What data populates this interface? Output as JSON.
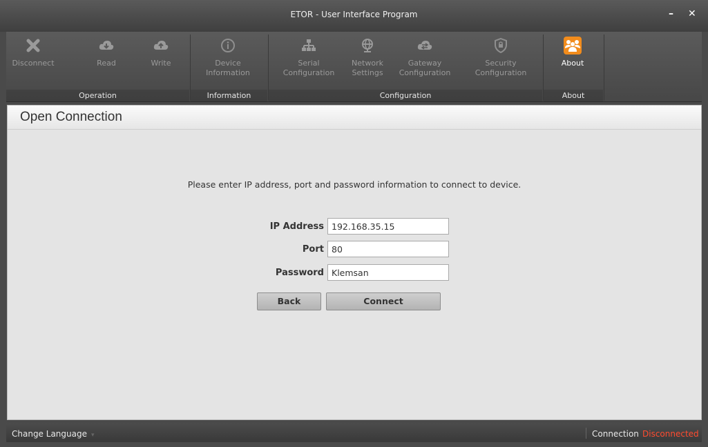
{
  "window": {
    "title": "ETOR - User Interface Program",
    "minimize": "–",
    "close": "✕"
  },
  "ribbon": {
    "buttons": [
      {
        "label": "Disconnect",
        "icon": "x-icon"
      },
      {
        "label": "Read",
        "icon": "cloud-download-icon"
      },
      {
        "label": "Write",
        "icon": "cloud-upload-icon"
      },
      {
        "label": "Device\nInformation",
        "label1": "Device",
        "label2": "Information",
        "icon": "info-icon"
      },
      {
        "label1": "Serial",
        "label2": "Configuration",
        "icon": "network-tree-icon"
      },
      {
        "label1": "Network",
        "label2": "Settings",
        "icon": "globe-network-icon"
      },
      {
        "label1": "Gateway",
        "label2": "Configuration",
        "icon": "gateway-icon"
      },
      {
        "label1": "Security",
        "label2": "Configuration",
        "icon": "shield-icon"
      },
      {
        "label": "About",
        "icon": "people-icon",
        "active": true
      }
    ],
    "groups": {
      "operation": "Operation",
      "information": "Information",
      "configuration": "Configuration",
      "about": "About"
    }
  },
  "panel": {
    "title": "Open Connection",
    "instruction": "Please enter IP address, port and password information to connect to device.",
    "fields": {
      "ip": {
        "label": "IP Address",
        "value": "192.168.35.15"
      },
      "port": {
        "label": "Port",
        "value": "80"
      },
      "password": {
        "label": "Password",
        "value": "Klemsan"
      }
    },
    "back_label": "Back",
    "connect_label": "Connect"
  },
  "status": {
    "language": "Change Language",
    "connection_label": "Connection",
    "connection_value": "Disconnected"
  },
  "colors": {
    "accent": "#f28c1c",
    "disconnected": "#ff4b2f"
  }
}
